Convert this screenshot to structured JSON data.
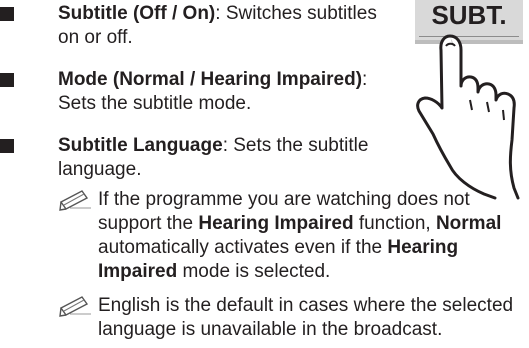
{
  "items": [
    {
      "bold": "Subtitle (Off / On)",
      "rest": ": Switches subtitles",
      "line2": "on or off."
    },
    {
      "bold": "Mode (Normal / Hearing Impaired)",
      "rest": ":",
      "line2": "Sets the subtitle mode."
    },
    {
      "bold": "Subtitle Language",
      "rest": ": Sets the subtitle",
      "line2": "language."
    }
  ],
  "notes": [
    {
      "l1": "If the programme you are watching does not",
      "l2a": "support the ",
      "l2b": "Hearing Impaired",
      "l2c": " function, ",
      "l2d": "Normal",
      "l3a": "automatically activates even if the ",
      "l3b": "Hearing",
      "l4a": "Impaired",
      "l4b": " mode is selected."
    },
    {
      "l1": "English is the default in cases where the selected",
      "l2": "language is unavailable in the broadcast."
    }
  ],
  "button": {
    "label": "SUBT."
  },
  "icons": {
    "note": "pencil-note-icon",
    "hand": "pointing-hand-icon"
  }
}
